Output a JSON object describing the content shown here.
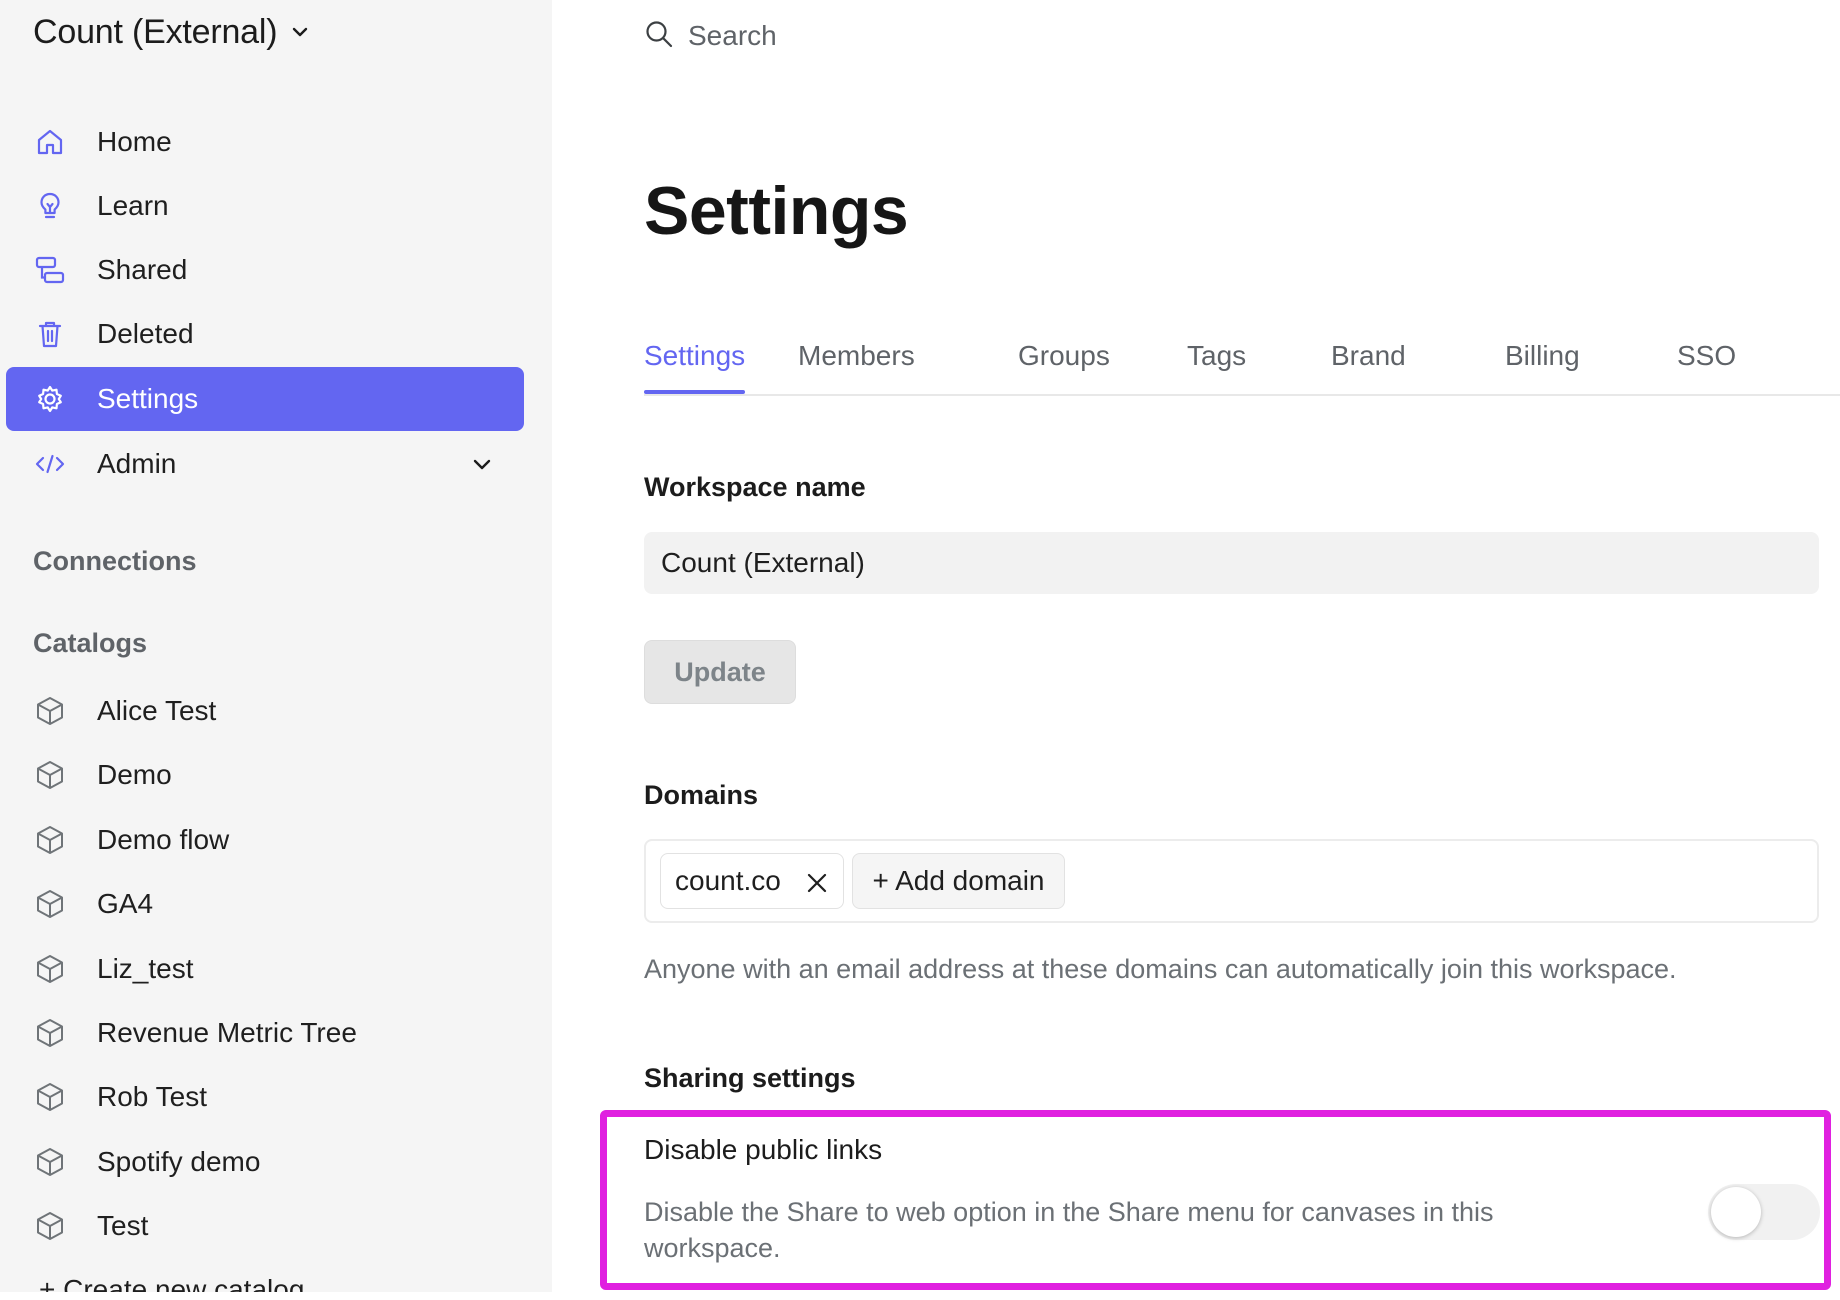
{
  "workspace": {
    "name": "Count (External)"
  },
  "sidebar": {
    "nav": [
      {
        "label": "Home",
        "icon": "home-icon"
      },
      {
        "label": "Learn",
        "icon": "lightbulb-icon"
      },
      {
        "label": "Shared",
        "icon": "shared-icon"
      },
      {
        "label": "Deleted",
        "icon": "trash-icon"
      },
      {
        "label": "Settings",
        "icon": "gear-icon",
        "active": true
      },
      {
        "label": "Admin",
        "icon": "code-icon"
      }
    ],
    "connections_heading": "Connections",
    "catalogs_heading": "Catalogs",
    "catalogs": [
      "Alice Test",
      "Demo",
      "Demo flow",
      "GA4",
      "Liz_test",
      "Revenue Metric Tree",
      "Rob Test",
      "Spotify demo",
      "Test"
    ],
    "create_catalog": "+ Create new catalog"
  },
  "search": {
    "placeholder": "Search"
  },
  "page": {
    "title": "Settings",
    "tabs": [
      "Settings",
      "Members",
      "Groups",
      "Tags",
      "Brand",
      "Billing",
      "SSO"
    ],
    "workspace_name_label": "Workspace name",
    "workspace_name_value": "Count (External)",
    "update_label": "Update",
    "domains_label": "Domains",
    "domains": [
      "count.co"
    ],
    "add_domain_label": "+ Add domain",
    "domains_help": "Anyone with an email address at these domains can automatically join this workspace.",
    "sharing_label": "Sharing settings",
    "public_links_title": "Disable public links",
    "public_links_desc": "Disable the Share to web option in the Share menu for canvases in this workspace.",
    "public_links_enabled": false
  },
  "colors": {
    "accent": "#6366f1",
    "highlight": "#e020e0",
    "sidebar_bg": "#f5f5f5"
  }
}
